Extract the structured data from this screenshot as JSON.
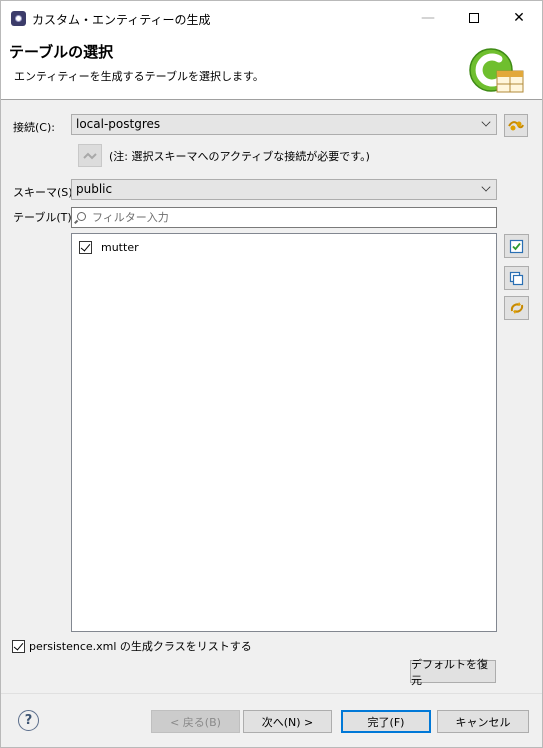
{
  "window": {
    "title": "カスタム・エンティティーの生成",
    "minimize_glyph": "—",
    "close_glyph": "✕"
  },
  "header": {
    "title": "テーブルの選択",
    "description": "エンティティーを生成するテーブルを選択します。"
  },
  "connection": {
    "label": "接続(C):",
    "value": "local-postgres",
    "note": "(注: 選択スキーマへのアクティブな接続が必要です。)"
  },
  "schema": {
    "label": "スキーマ(S):",
    "value": "public"
  },
  "tables": {
    "label": "テーブル(T):",
    "filter_placeholder": "フィルター入力",
    "items": [
      {
        "name": "mutter",
        "checked": true
      }
    ]
  },
  "options": {
    "persistence_label": "persistence.xml の生成クラスをリストする",
    "persistence_checked": true,
    "restore_defaults_label": "デフォルトを復元"
  },
  "footer": {
    "help_glyph": "?",
    "back_label": "< 戻る(B)",
    "next_label": "次へ(N) >",
    "finish_label": "完了(F)",
    "cancel_label": "キャンセル"
  },
  "colors": {
    "accent": "#0078d7",
    "dialog_bg": "#f0f0f0"
  }
}
